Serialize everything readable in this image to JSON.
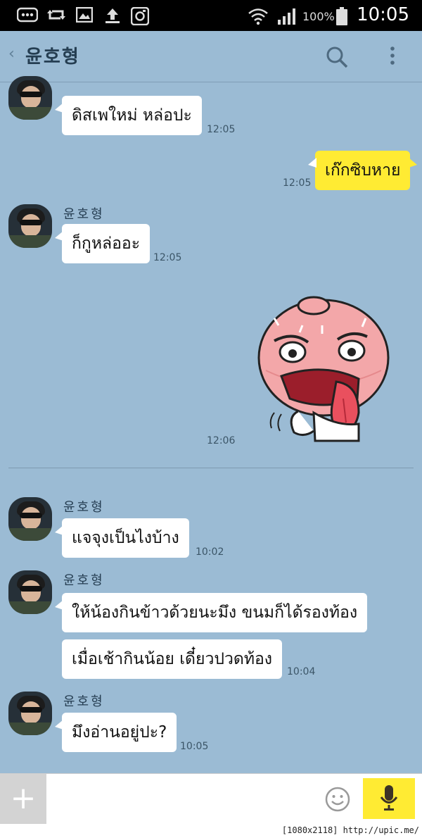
{
  "status_bar": {
    "battery": "100%",
    "clock": "10:05",
    "icons": [
      "more-icon",
      "retweet-icon",
      "image-icon",
      "upload-icon",
      "instagram-icon",
      "wifi-icon",
      "signal-icon",
      "battery-icon"
    ]
  },
  "header": {
    "back": "‹",
    "title": "윤호형",
    "search_icon": "search-icon",
    "menu_icon": "more-vertical-icon"
  },
  "messages": [
    {
      "from": "윤호형",
      "text": "ดิสเพใหม่ หล่อปะ",
      "time": "12:05"
    },
    {
      "from": "me",
      "text": "เก๊กซิบหาย",
      "time": "12:05"
    },
    {
      "from": "윤호형",
      "name": "윤호형",
      "text": "ก็กูหล่ออะ",
      "time": "12:05"
    },
    {
      "from": "me",
      "sticker": "peach-sticker",
      "time": "12:06"
    },
    {
      "from": "윤호형",
      "name": "윤호형",
      "text": "แจจุงเป็นไงบ้าง",
      "time": "10:02"
    },
    {
      "from": "윤호형",
      "name": "윤호형",
      "text": "ให้น้องกินข้าวด้วยนะมึง ขนมก็ได้รองท้อง",
      "text2": "เมื่อเช้ากินน้อย เดี๋ยวปวดท้อง",
      "time": "10:04"
    },
    {
      "from": "윤호형",
      "name": "윤호형",
      "text": "มึงอ่านอยู่ปะ?",
      "time": "10:05"
    }
  ],
  "input": {
    "plus_label": "+",
    "emoji_icon": "smile-icon",
    "mic_icon": "mic-icon"
  },
  "footer": {
    "tag": "[1080x2118] http://upic.me/"
  },
  "colors": {
    "chat_bg": "#9bbbd4",
    "my_bubble": "#ffeb33",
    "other_bubble": "#ffffff"
  }
}
